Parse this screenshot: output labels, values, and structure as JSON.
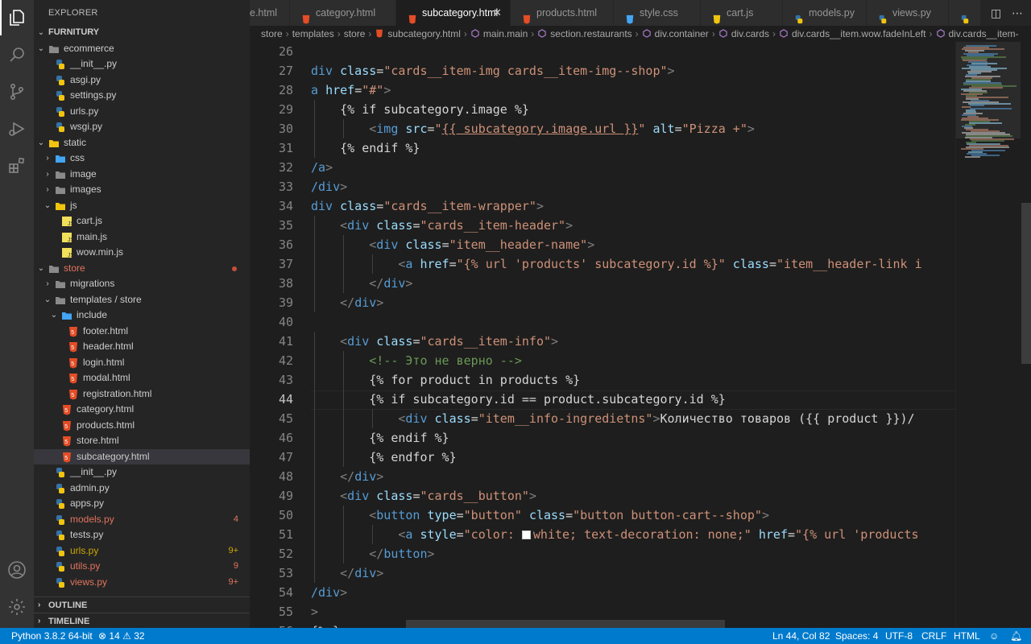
{
  "explorer": {
    "title": "EXPLORER",
    "root": "FURNITURY",
    "items": [
      {
        "label": "ecommerce",
        "type": "folder-open",
        "color": "#cccccc"
      },
      {
        "label": "__init__.py",
        "type": "py",
        "color": "#cccccc"
      },
      {
        "label": "asgi.py",
        "type": "py",
        "color": "#cccccc"
      },
      {
        "label": "settings.py",
        "type": "py",
        "color": "#cccccc"
      },
      {
        "label": "urls.py",
        "type": "py",
        "color": "#cccccc"
      },
      {
        "label": "wsgi.py",
        "type": "py",
        "color": "#cccccc"
      },
      {
        "label": "static",
        "type": "folder-open",
        "color": "#cccccc"
      },
      {
        "label": "css",
        "type": "folder",
        "color": "#cccccc"
      },
      {
        "label": "image",
        "type": "folder",
        "color": "#cccccc"
      },
      {
        "label": "images",
        "type": "folder",
        "color": "#cccccc"
      },
      {
        "label": "js",
        "type": "folder-open",
        "color": "#cccccc"
      },
      {
        "label": "cart.js",
        "type": "js",
        "color": "#cccccc"
      },
      {
        "label": "main.js",
        "type": "js",
        "color": "#cccccc"
      },
      {
        "label": "wow.min.js",
        "type": "js",
        "color": "#cccccc"
      },
      {
        "label": "store",
        "type": "folder-open",
        "color": "#e2745c"
      },
      {
        "label": "migrations",
        "type": "folder",
        "color": "#cccccc"
      },
      {
        "label": "templates / store",
        "type": "folder-open",
        "color": "#cccccc"
      },
      {
        "label": "include",
        "type": "folder-open",
        "color": "#cccccc"
      },
      {
        "label": "footer.html",
        "type": "html",
        "color": "#cccccc"
      },
      {
        "label": "header.html",
        "type": "html",
        "color": "#cccccc"
      },
      {
        "label": "login.html",
        "type": "html",
        "color": "#cccccc"
      },
      {
        "label": "modal.html",
        "type": "html",
        "color": "#cccccc"
      },
      {
        "label": "registration.html",
        "type": "html",
        "color": "#cccccc"
      },
      {
        "label": "category.html",
        "type": "html",
        "color": "#cccccc"
      },
      {
        "label": "products.html",
        "type": "html",
        "color": "#cccccc"
      },
      {
        "label": "store.html",
        "type": "html",
        "color": "#cccccc"
      },
      {
        "label": "subcategory.html",
        "type": "html",
        "color": "#cccccc"
      },
      {
        "label": "__init__.py",
        "type": "py",
        "color": "#cccccc"
      },
      {
        "label": "admin.py",
        "type": "py",
        "color": "#cccccc"
      },
      {
        "label": "apps.py",
        "type": "py",
        "color": "#cccccc"
      },
      {
        "label": "models.py",
        "type": "py",
        "color": "#e2745c",
        "badge": "4"
      },
      {
        "label": "tests.py",
        "type": "py",
        "color": "#cccccc"
      },
      {
        "label": "urls.py",
        "type": "py",
        "color": "#cca700",
        "badge": "9+"
      },
      {
        "label": "utils.py",
        "type": "py",
        "color": "#e2745c",
        "badge": "9"
      },
      {
        "label": "views.py",
        "type": "py",
        "color": "#e2745c",
        "badge": "9+"
      }
    ],
    "outline": "OUTLINE",
    "timeline": "TIMELINE"
  },
  "tabs": [
    {
      "label": "e.html",
      "type": "html"
    },
    {
      "label": "category.html",
      "type": "html"
    },
    {
      "label": "subcategory.html",
      "type": "html",
      "active": true
    },
    {
      "label": "products.html",
      "type": "html"
    },
    {
      "label": "style.css",
      "type": "css"
    },
    {
      "label": "cart.js",
      "type": "js"
    },
    {
      "label": "models.py",
      "type": "py"
    },
    {
      "label": "views.py",
      "type": "py"
    },
    {
      "label": "",
      "type": "py"
    }
  ],
  "breadcrumb": [
    "store",
    "templates",
    "store",
    "subcategory.html",
    "main.main",
    "section.restaurants",
    "div.container",
    "div.cards",
    "div.cards__item.wow.fadeInLeft",
    "div.cards__item-"
  ],
  "editor": {
    "lines": [
      {
        "n": "26",
        "code": ""
      },
      {
        "n": "27",
        "code": "div class=\"cards__item-img cards__item-img--shop\">"
      },
      {
        "n": "28",
        "code": "a href=\"#\">"
      },
      {
        "n": "29",
        "code": "    {% if subcategory.image %}"
      },
      {
        "n": "30",
        "code": "        <img src=\"{{ subcategory.image.url }}\" alt=\"Pizza +\">"
      },
      {
        "n": "31",
        "code": "    {% endif %}"
      },
      {
        "n": "32",
        "code": "/a>"
      },
      {
        "n": "33",
        "code": "/div>"
      },
      {
        "n": "34",
        "code": "div class=\"cards__item-wrapper\">"
      },
      {
        "n": "35",
        "code": "    <div class=\"cards__item-header\">"
      },
      {
        "n": "36",
        "code": "        <div class=\"item__header-name\">"
      },
      {
        "n": "37",
        "code": "            <a href=\"{% url 'products' subcategory.id %}\" class=\"item__header-link i"
      },
      {
        "n": "38",
        "code": "        </div>"
      },
      {
        "n": "39",
        "code": "    </div>"
      },
      {
        "n": "40",
        "code": ""
      },
      {
        "n": "41",
        "code": "    <div class=\"cards__item-info\">"
      },
      {
        "n": "42",
        "code": "        <!-- Это не верно -->"
      },
      {
        "n": "43",
        "code": "        {% for product in products %}"
      },
      {
        "n": "44",
        "code": "        {% if subcategory.id == product.subcategory.id %}"
      },
      {
        "n": "45",
        "code": "            <div class=\"item__info-ingredietns\">Количество товаров ({{ product }})</"
      },
      {
        "n": "46",
        "code": "        {% endif %}"
      },
      {
        "n": "47",
        "code": "        {% endfor %}"
      },
      {
        "n": "48",
        "code": "    </div>"
      },
      {
        "n": "49",
        "code": "    <div class=\"cards__button\">"
      },
      {
        "n": "50",
        "code": "        <button type=\"button\" class=\"button button-cart--shop\">"
      },
      {
        "n": "51",
        "code": "            <a style=\"color: white; text-decoration: none;\" href=\"{% url 'products"
      },
      {
        "n": "52",
        "code": "        </button>"
      },
      {
        "n": "53",
        "code": "    </div>"
      },
      {
        "n": "54",
        "code": "/div>"
      },
      {
        "n": "55",
        "code": ">"
      },
      {
        "n": "56",
        "code": "{% }"
      }
    ]
  },
  "status": {
    "python": "Python 3.8.2 64-bit",
    "errors": "14",
    "warnings": "32",
    "position": "Ln 44, Col 82",
    "spaces": "Spaces: 4",
    "encoding": "UTF-8",
    "eol": "CRLF",
    "language": "HTML"
  },
  "colors": {
    "status_bar": "#007acc",
    "activity_bar": "#333333",
    "sidebar": "#252526",
    "editor": "#1e1e1e"
  }
}
